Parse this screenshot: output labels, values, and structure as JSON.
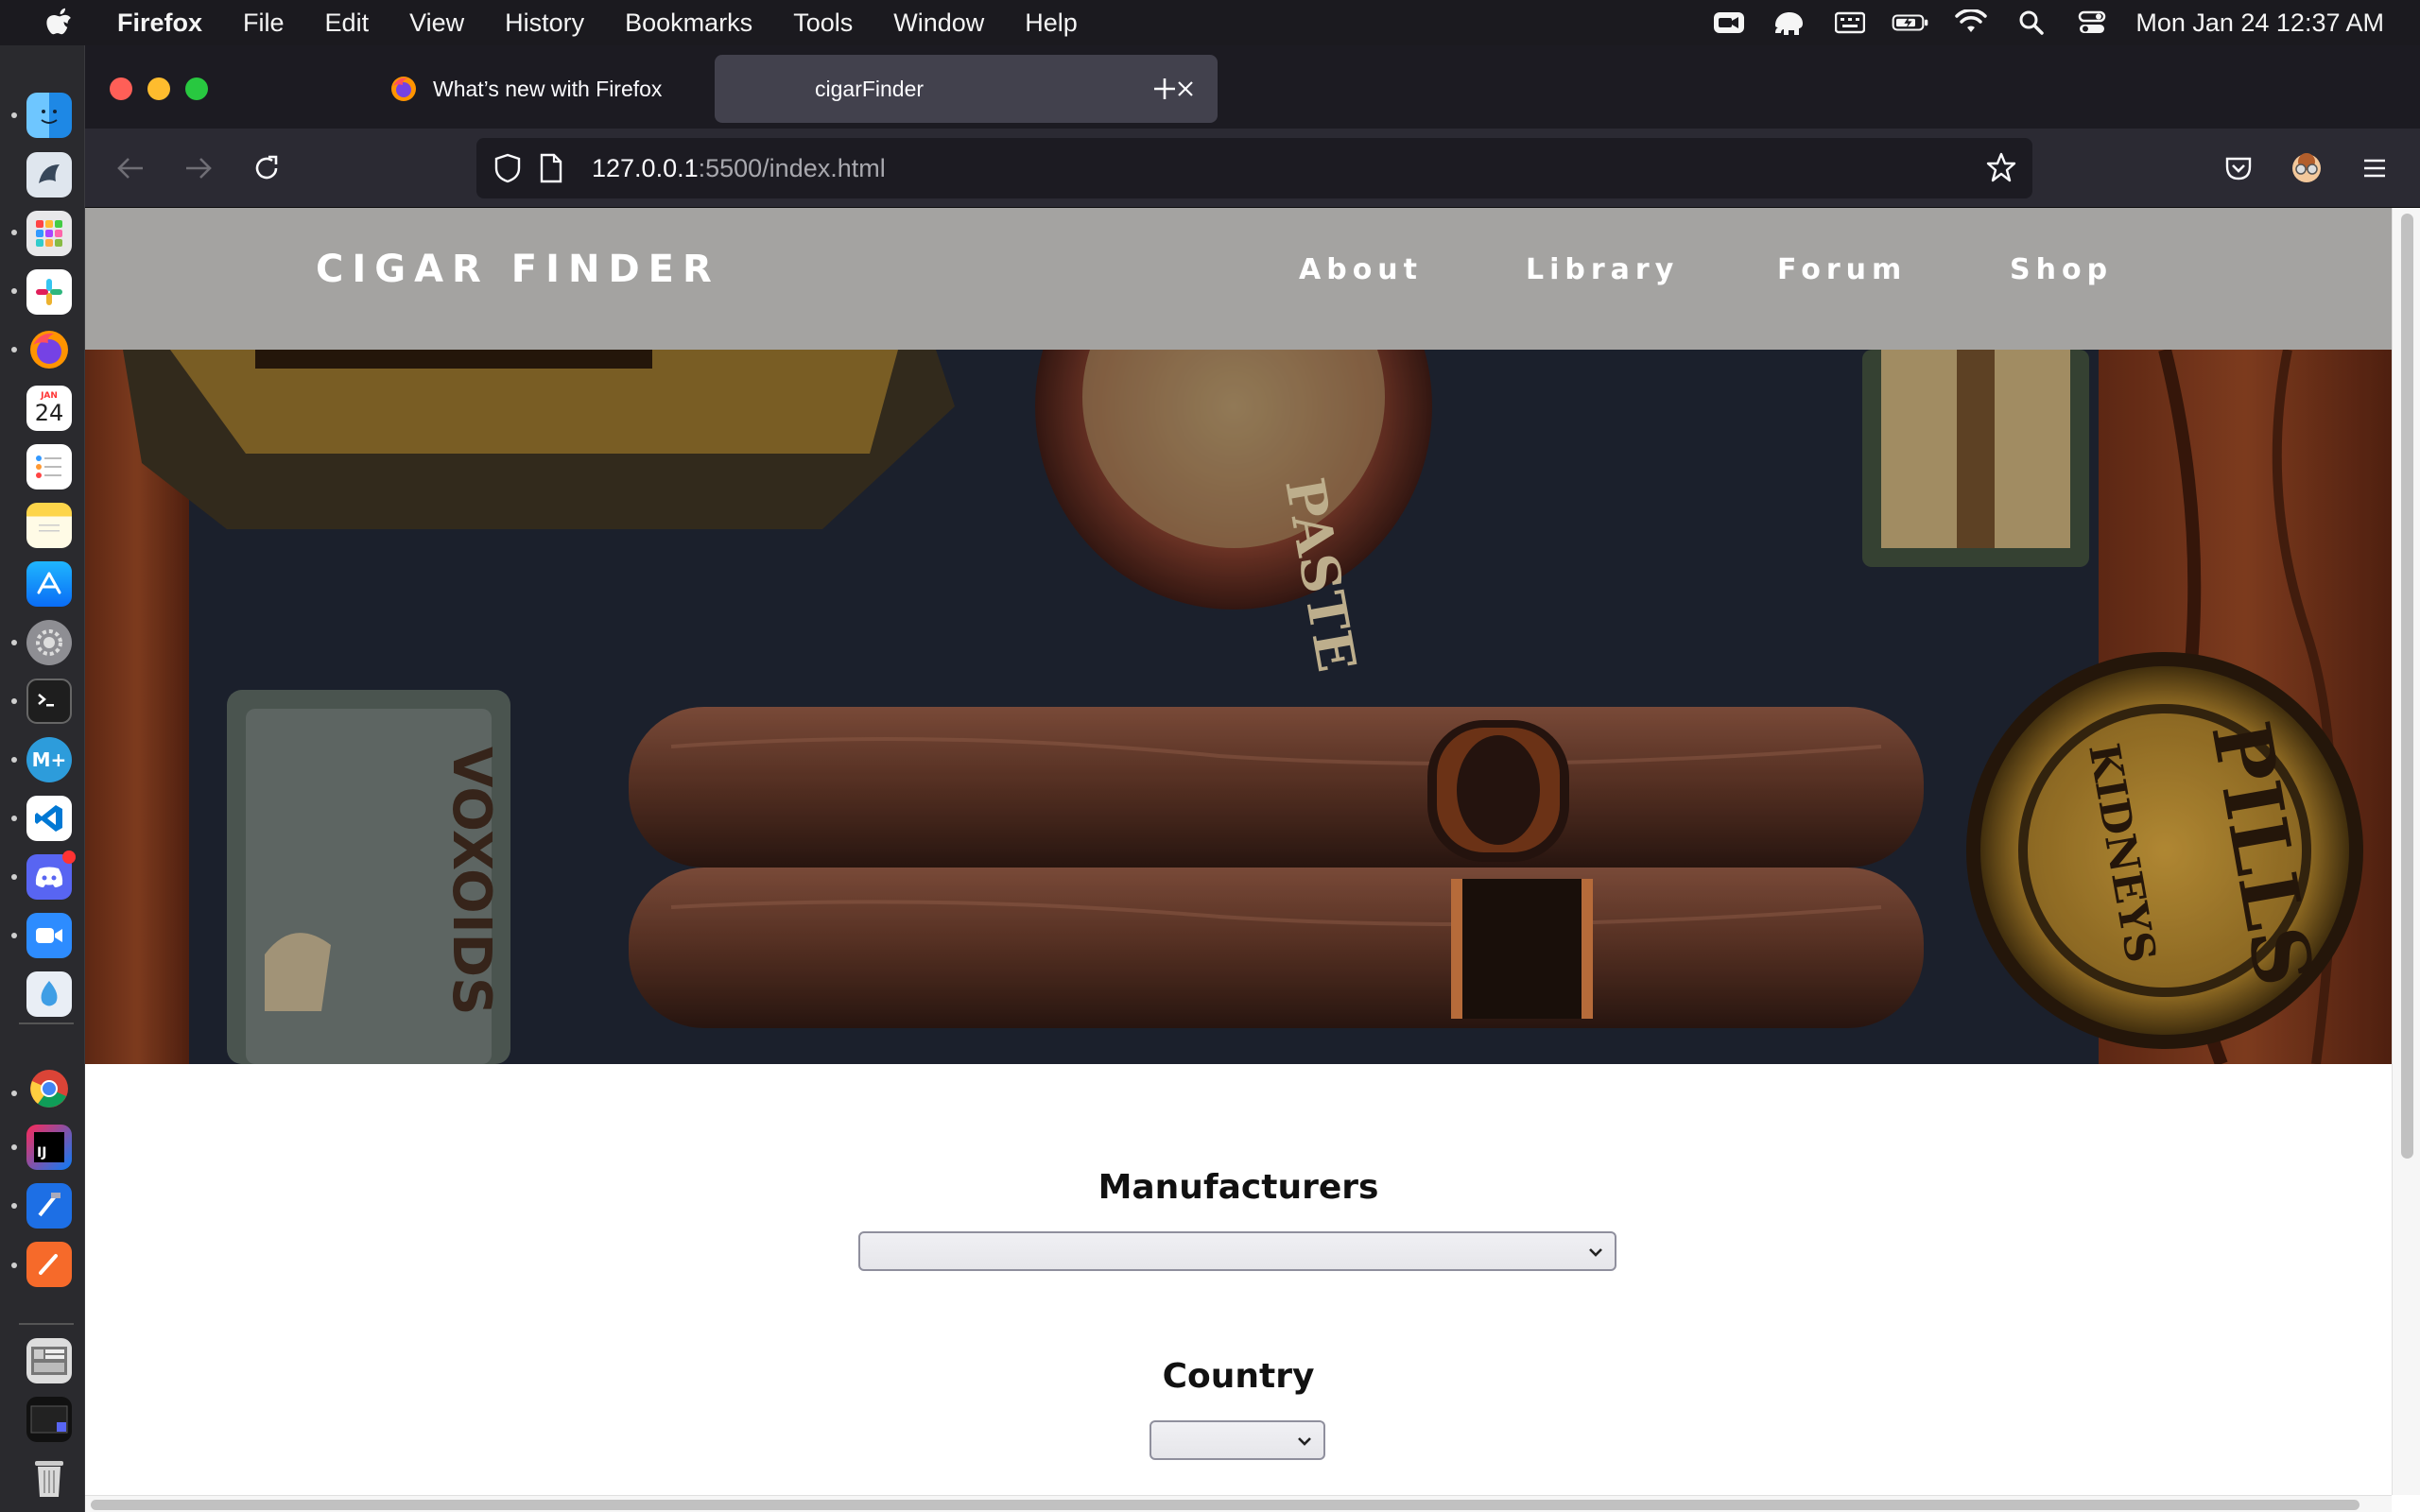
{
  "menubar": {
    "app_name": "Firefox",
    "items": [
      "File",
      "Edit",
      "View",
      "History",
      "Bookmarks",
      "Tools",
      "Window",
      "Help"
    ],
    "clock": "Mon Jan 24  12:37 AM",
    "status_icons": [
      "facetime-icon",
      "elephant-icon",
      "keyboard-icon",
      "battery-icon",
      "wifi-icon",
      "search-icon",
      "control-center-icon"
    ]
  },
  "dock": {
    "apps": [
      "finder",
      "maccy",
      "launchpad",
      "slack",
      "firefox",
      "calendar",
      "reminders",
      "notes",
      "app-store",
      "system-preferences",
      "terminal",
      "markdown",
      "vscode",
      "discord",
      "zoom",
      "raindrop",
      "chrome",
      "intellij",
      "xcode",
      "brush",
      "screenshot",
      "terminal-window",
      "trash"
    ],
    "calendar_month": "JAN",
    "calendar_day": "24"
  },
  "browser": {
    "tabs": [
      {
        "title": "What’s new with Firefox",
        "active": false
      },
      {
        "title": "cigarFinder",
        "active": true
      }
    ],
    "url_host": "127.0.0.1",
    "url_path": ":5500/index.html"
  },
  "site": {
    "logo": "CIGAR FINDER",
    "nav": [
      "About",
      "Library",
      "Forum",
      "Shop"
    ],
    "sections": [
      {
        "title": "Manufacturers",
        "selected": ""
      },
      {
        "title": "Country",
        "selected": ""
      }
    ],
    "hero_labels": {
      "tin_left": "VOXOIDS",
      "tin_right_top": "PILLS",
      "tin_right_bottom": "KIDNEYS",
      "tin_center": "PASTE"
    }
  },
  "colors": {
    "header_bg": "#a4a3a1",
    "active_tab": "#42414d",
    "toolbar": "#2b2a33"
  }
}
